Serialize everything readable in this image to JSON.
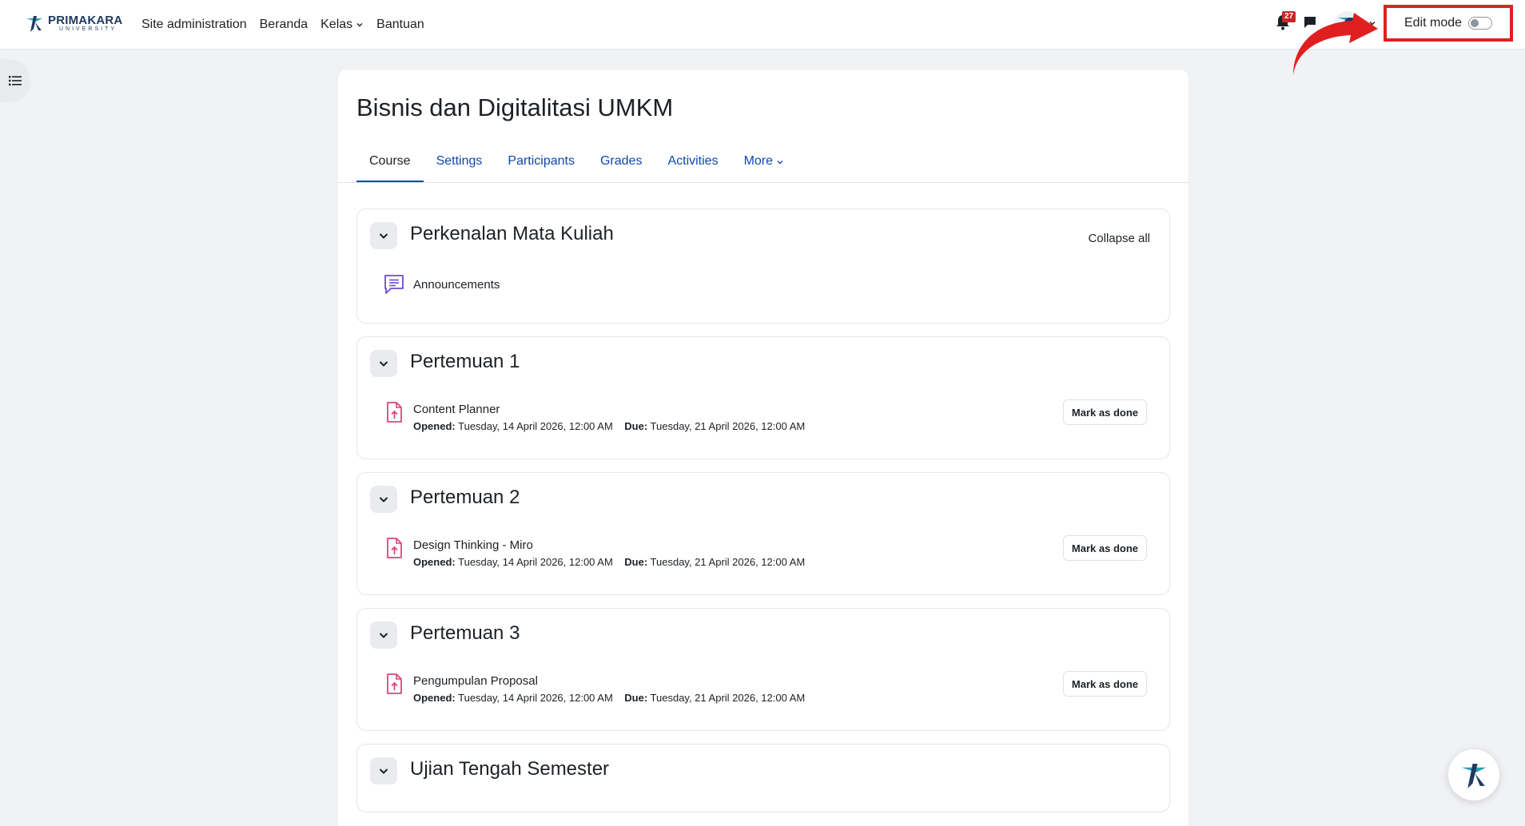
{
  "brand": {
    "name": "PRIMAKARA",
    "sub": "UNIVERSITY"
  },
  "nav": {
    "links": [
      "Site administration",
      "Beranda",
      "Kelas",
      "Bantuan"
    ],
    "notifications_count": "27",
    "edit_mode_label": "Edit mode"
  },
  "course": {
    "title": "Bisnis dan Digitalitasi UMKM",
    "tabs": [
      "Course",
      "Settings",
      "Participants",
      "Grades",
      "Activities",
      "More"
    ],
    "collapse_all": "Collapse all"
  },
  "sections": [
    {
      "title": "Perkenalan Mata Kuliah",
      "activity": {
        "name": "Announcements",
        "icon": "forum-icon"
      }
    },
    {
      "title": "Pertemuan 1",
      "activity": {
        "name": "Content Planner",
        "opened_label": "Opened:",
        "opened": "Tuesday, 14 April 2026, 12:00 AM",
        "due_label": "Due:",
        "due": "Tuesday, 21 April 2026, 12:00 AM",
        "button": "Mark as done",
        "icon": "assignment-icon"
      }
    },
    {
      "title": "Pertemuan 2",
      "activity": {
        "name": "Design Thinking - Miro",
        "opened_label": "Opened:",
        "opened": "Tuesday, 14 April 2026, 12:00 AM",
        "due_label": "Due:",
        "due": "Tuesday, 21 April 2026, 12:00 AM",
        "button": "Mark as done",
        "icon": "assignment-icon"
      }
    },
    {
      "title": "Pertemuan 3",
      "activity": {
        "name": "Pengumpulan Proposal",
        "opened_label": "Opened:",
        "opened": "Tuesday, 14 April 2026, 12:00 AM",
        "due_label": "Due:",
        "due": "Tuesday, 21 April 2026, 12:00 AM",
        "button": "Mark as done",
        "icon": "assignment-icon"
      }
    },
    {
      "title": "Ujian Tengah Semester"
    }
  ],
  "colors": {
    "link": "#0f47ad",
    "highlight": "#e02020",
    "assignment": "#e0447a",
    "forum": "#6c4ccf"
  }
}
